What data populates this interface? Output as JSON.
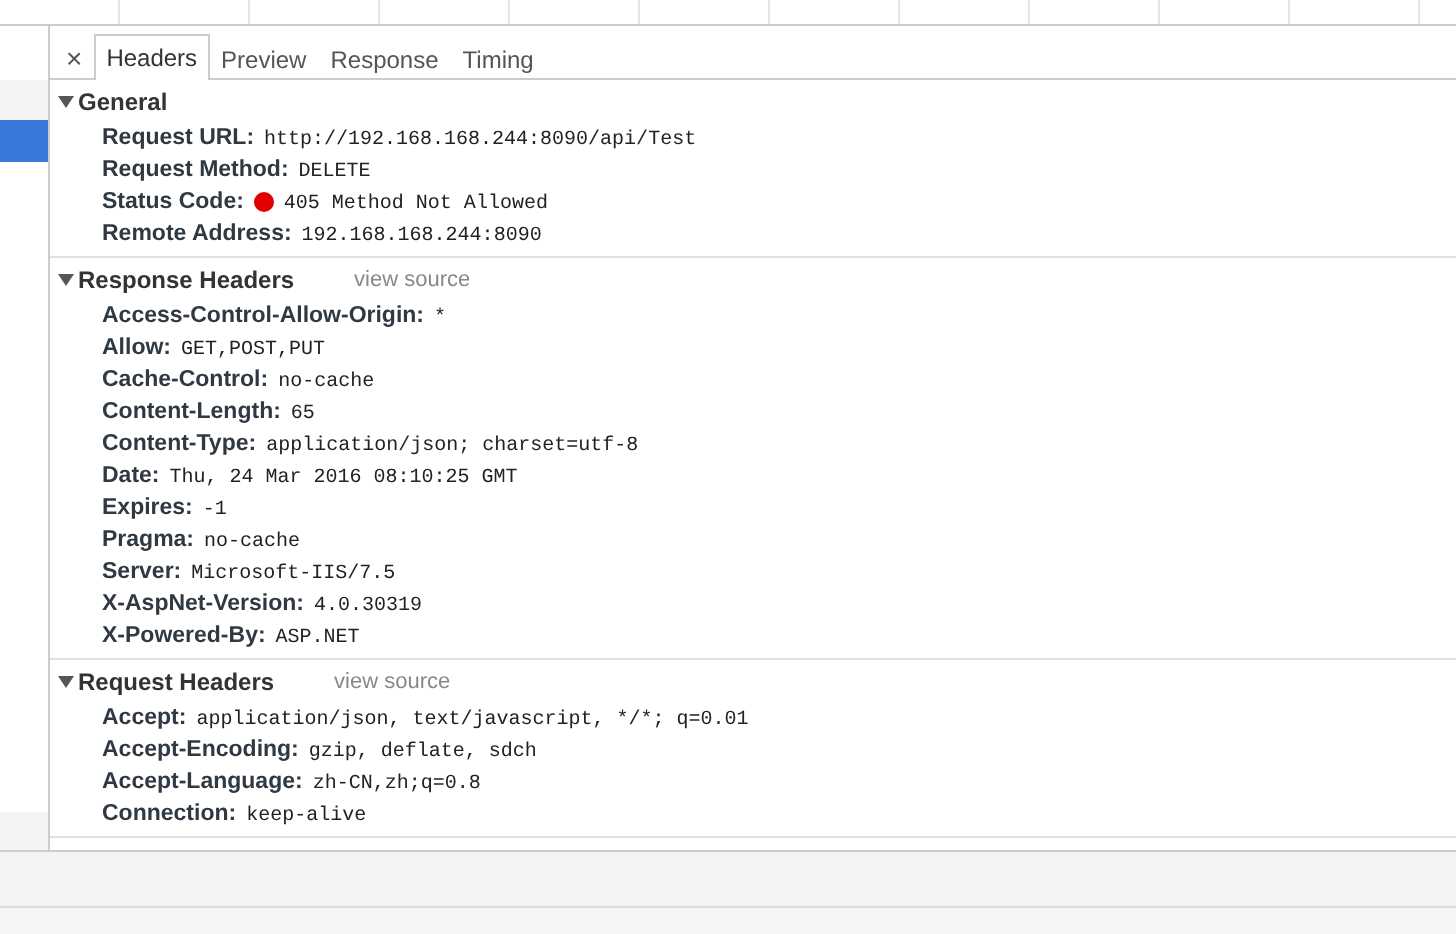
{
  "request_rows": [
    {
      "selected": false
    },
    {
      "selected": true
    }
  ],
  "tabs": [
    {
      "kind": "close",
      "label": "×",
      "selected": false
    },
    {
      "kind": "tab",
      "label": "Headers",
      "selected": true
    },
    {
      "kind": "tab",
      "label": "Preview",
      "selected": false
    },
    {
      "kind": "tab",
      "label": "Response",
      "selected": false
    },
    {
      "kind": "tab",
      "label": "Timing",
      "selected": false
    }
  ],
  "sections": [
    {
      "title": "General",
      "expanded": true,
      "headers": [
        {
          "name": "Request URL:",
          "value": "http://192.168.168.244:8090/api/Test"
        },
        {
          "name": "Request Method:",
          "value": "DELETE"
        },
        {
          "name": "Status Code:",
          "value": "405 Method Not Allowed",
          "color": "#e00000"
        },
        {
          "name": "Remote Address:",
          "value": "192.168.168.244:8090"
        }
      ]
    },
    {
      "title": "Response Headers",
      "link": "view source",
      "expanded": true,
      "headers": [
        {
          "name": "Access-Control-Allow-Origin:",
          "value": "*"
        },
        {
          "name": "Allow:",
          "value": "GET,POST,PUT"
        },
        {
          "name": "Cache-Control:",
          "value": "no-cache"
        },
        {
          "name": "Content-Length:",
          "value": "65"
        },
        {
          "name": "Content-Type:",
          "value": "application/json; charset=utf-8"
        },
        {
          "name": "Date:",
          "value": "Thu, 24 Mar 2016 08:10:25 GMT"
        },
        {
          "name": "Expires:",
          "value": "-1"
        },
        {
          "name": "Pragma:",
          "value": "no-cache"
        },
        {
          "name": "Server:",
          "value": "Microsoft-IIS/7.5"
        },
        {
          "name": "X-AspNet-Version:",
          "value": "4.0.30319"
        },
        {
          "name": "X-Powered-By:",
          "value": "ASP.NET"
        }
      ]
    },
    {
      "title": "Request Headers",
      "link": "view source",
      "expanded": true,
      "headers": [
        {
          "name": "Accept:",
          "value": "application/json, text/javascript, */*; q=0.01"
        },
        {
          "name": "Accept-Encoding:",
          "value": "gzip, deflate, sdch"
        },
        {
          "name": "Accept-Language:",
          "value": "zh-CN,zh;q=0.8"
        },
        {
          "name": "Connection:",
          "value": "keep-alive"
        }
      ]
    }
  ]
}
